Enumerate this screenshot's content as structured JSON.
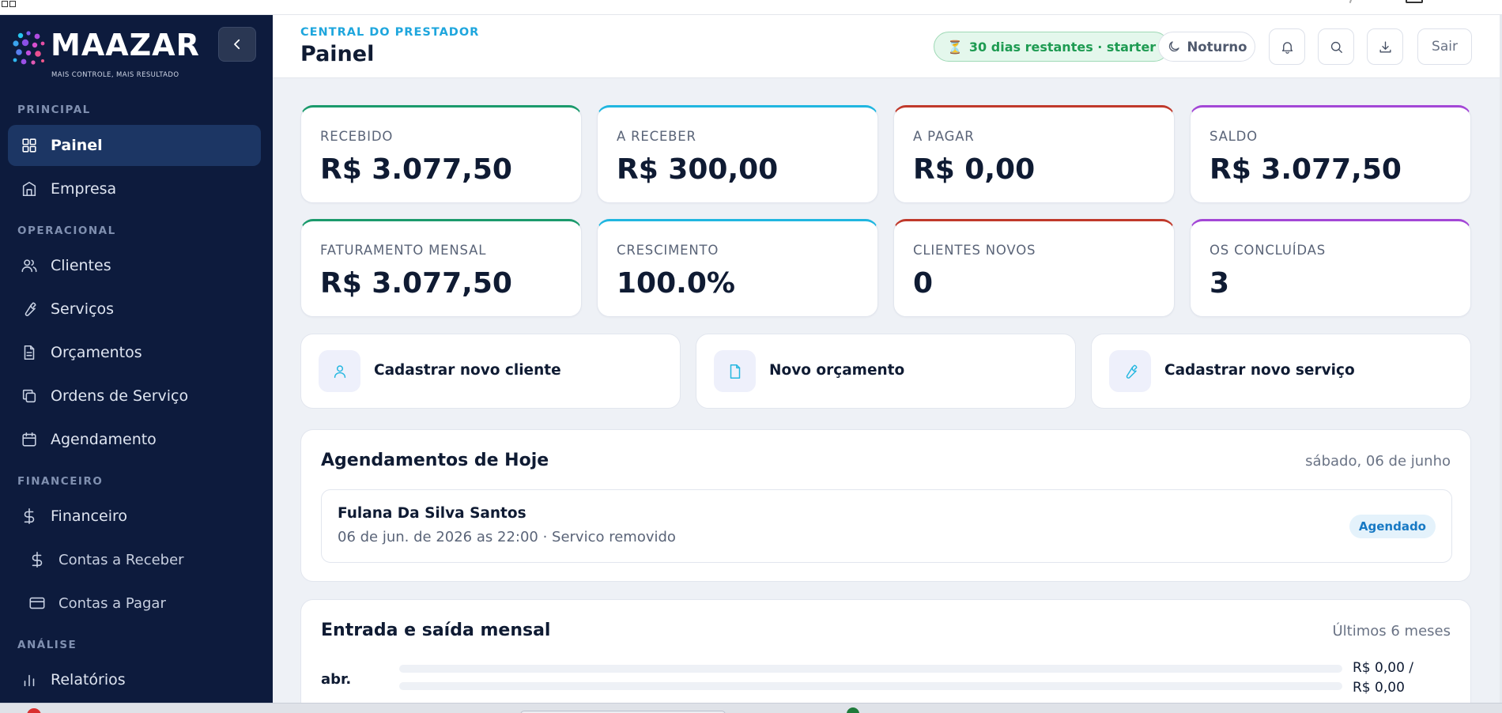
{
  "brand": {
    "name": "MAAZAR",
    "tagline": "MAIS CONTROLE, MAIS RESULTADO"
  },
  "sidebar": {
    "sections": [
      {
        "label": "PRINCIPAL"
      },
      {
        "label": "OPERACIONAL"
      },
      {
        "label": "FINANCEIRO"
      },
      {
        "label": "ANÁLISE"
      }
    ],
    "items": [
      {
        "label": "Painel",
        "icon": "grid-icon",
        "active": true
      },
      {
        "label": "Empresa",
        "icon": "building-icon"
      },
      {
        "label": "Clientes",
        "icon": "users-icon"
      },
      {
        "label": "Serviços",
        "icon": "wrench-icon"
      },
      {
        "label": "Orçamentos",
        "icon": "document-icon"
      },
      {
        "label": "Ordens de Serviço",
        "icon": "copy-icon"
      },
      {
        "label": "Agendamento",
        "icon": "calendar-icon"
      },
      {
        "label": "Financeiro",
        "icon": "dollar-icon"
      },
      {
        "label": "Contas a Receber",
        "icon": "dollar-icon"
      },
      {
        "label": "Contas a Pagar",
        "icon": "credit-card-icon"
      },
      {
        "label": "Relatórios",
        "icon": "bar-chart-icon"
      }
    ]
  },
  "header": {
    "eyebrow": "CENTRAL DO PRESTADOR",
    "title": "Painel",
    "trial_badge": "30 dias restantes · starter",
    "theme_label": "Noturno",
    "logout_label": "Sair"
  },
  "stats": [
    {
      "label": "RECEBIDO",
      "value": "R$ 3.077,50",
      "color": "#1b9a6c"
    },
    {
      "label": "A RECEBER",
      "value": "R$ 300,00",
      "color": "#20b6e0"
    },
    {
      "label": "A PAGAR",
      "value": "R$ 0,00",
      "color": "#c0392b"
    },
    {
      "label": "SALDO",
      "value": "R$ 3.077,50",
      "color": "#a347d6"
    },
    {
      "label": "FATURAMENTO MENSAL",
      "value": "R$ 3.077,50",
      "color": "#1b9a6c"
    },
    {
      "label": "CRESCIMENTO",
      "value": "100.0%",
      "color": "#20b6e0"
    },
    {
      "label": "CLIENTES NOVOS",
      "value": "0",
      "color": "#c0392b"
    },
    {
      "label": "OS CONCLUÍDAS",
      "value": "3",
      "color": "#a347d6"
    }
  ],
  "actions": [
    {
      "label": "Cadastrar novo cliente",
      "icon": "user-icon"
    },
    {
      "label": "Novo orçamento",
      "icon": "file-icon"
    },
    {
      "label": "Cadastrar novo serviço",
      "icon": "wrench-icon"
    }
  ],
  "appointments": {
    "title": "Agendamentos de Hoje",
    "date": "sábado, 06 de junho",
    "items": [
      {
        "name": "Fulana Da Silva Santos",
        "desc": "06 de jun. de 2026 as 22:00 · Servico removido",
        "status": "Agendado"
      }
    ]
  },
  "cashflow": {
    "title": "Entrada e saída mensal",
    "period": "Últimos 6 meses",
    "rows": [
      {
        "month": "abr.",
        "in_amount": "R$ 0,00 /",
        "out_amount": "R$ 0,00",
        "in_fraction": 0,
        "out_fraction": 0
      }
    ]
  }
}
